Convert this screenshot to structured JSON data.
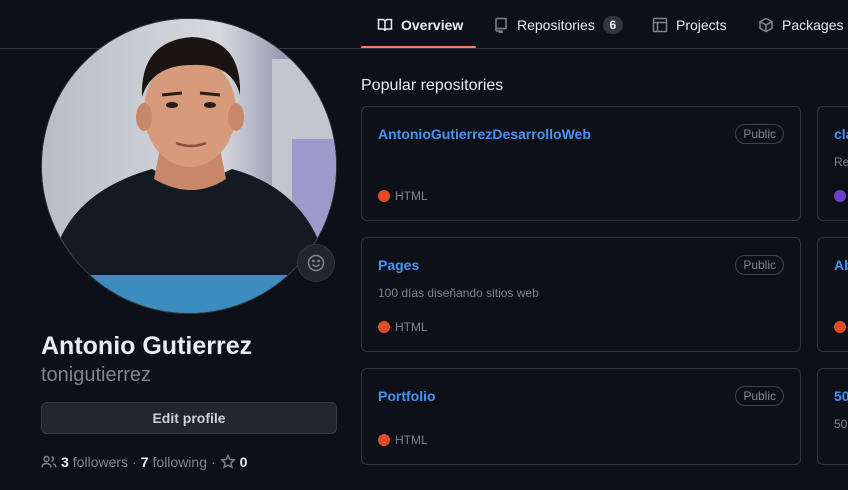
{
  "nav": {
    "tabs": [
      {
        "label": "Overview",
        "icon": "book-icon"
      },
      {
        "label": "Repositories",
        "icon": "repo-icon",
        "count": "6"
      },
      {
        "label": "Projects",
        "icon": "table-icon"
      },
      {
        "label": "Packages",
        "icon": "package-icon"
      }
    ]
  },
  "profile": {
    "name": "Antonio Gutierrez",
    "username": "tonigutierrez",
    "edit_label": "Edit profile",
    "followers_count": "3",
    "followers_label": "followers",
    "following_count": "7",
    "following_label": "following",
    "stars_count": "0"
  },
  "popular": {
    "title": "Popular repositories",
    "repos": [
      {
        "name": "AntonioGutierrezDesarrolloWeb",
        "visibility": "Public",
        "description": "",
        "language": "HTML"
      },
      {
        "name": "Pages",
        "visibility": "Public",
        "description": "100 días diseñando sitios web",
        "language": "HTML"
      },
      {
        "name": "Portfolio",
        "visibility": "Public",
        "description": "",
        "language": "HTML"
      }
    ],
    "partial_repos": [
      {
        "name_fragment": "cla",
        "desc_fragment": "Re"
      },
      {
        "name_fragment": "Ab",
        "desc_fragment": ""
      },
      {
        "name_fragment": "50",
        "desc_fragment": "50"
      }
    ]
  },
  "colors": {
    "accent_underline": "#f78166",
    "link": "#4493f8",
    "html_lang": "#e34c26",
    "purple_lang": "#6e40c9"
  }
}
